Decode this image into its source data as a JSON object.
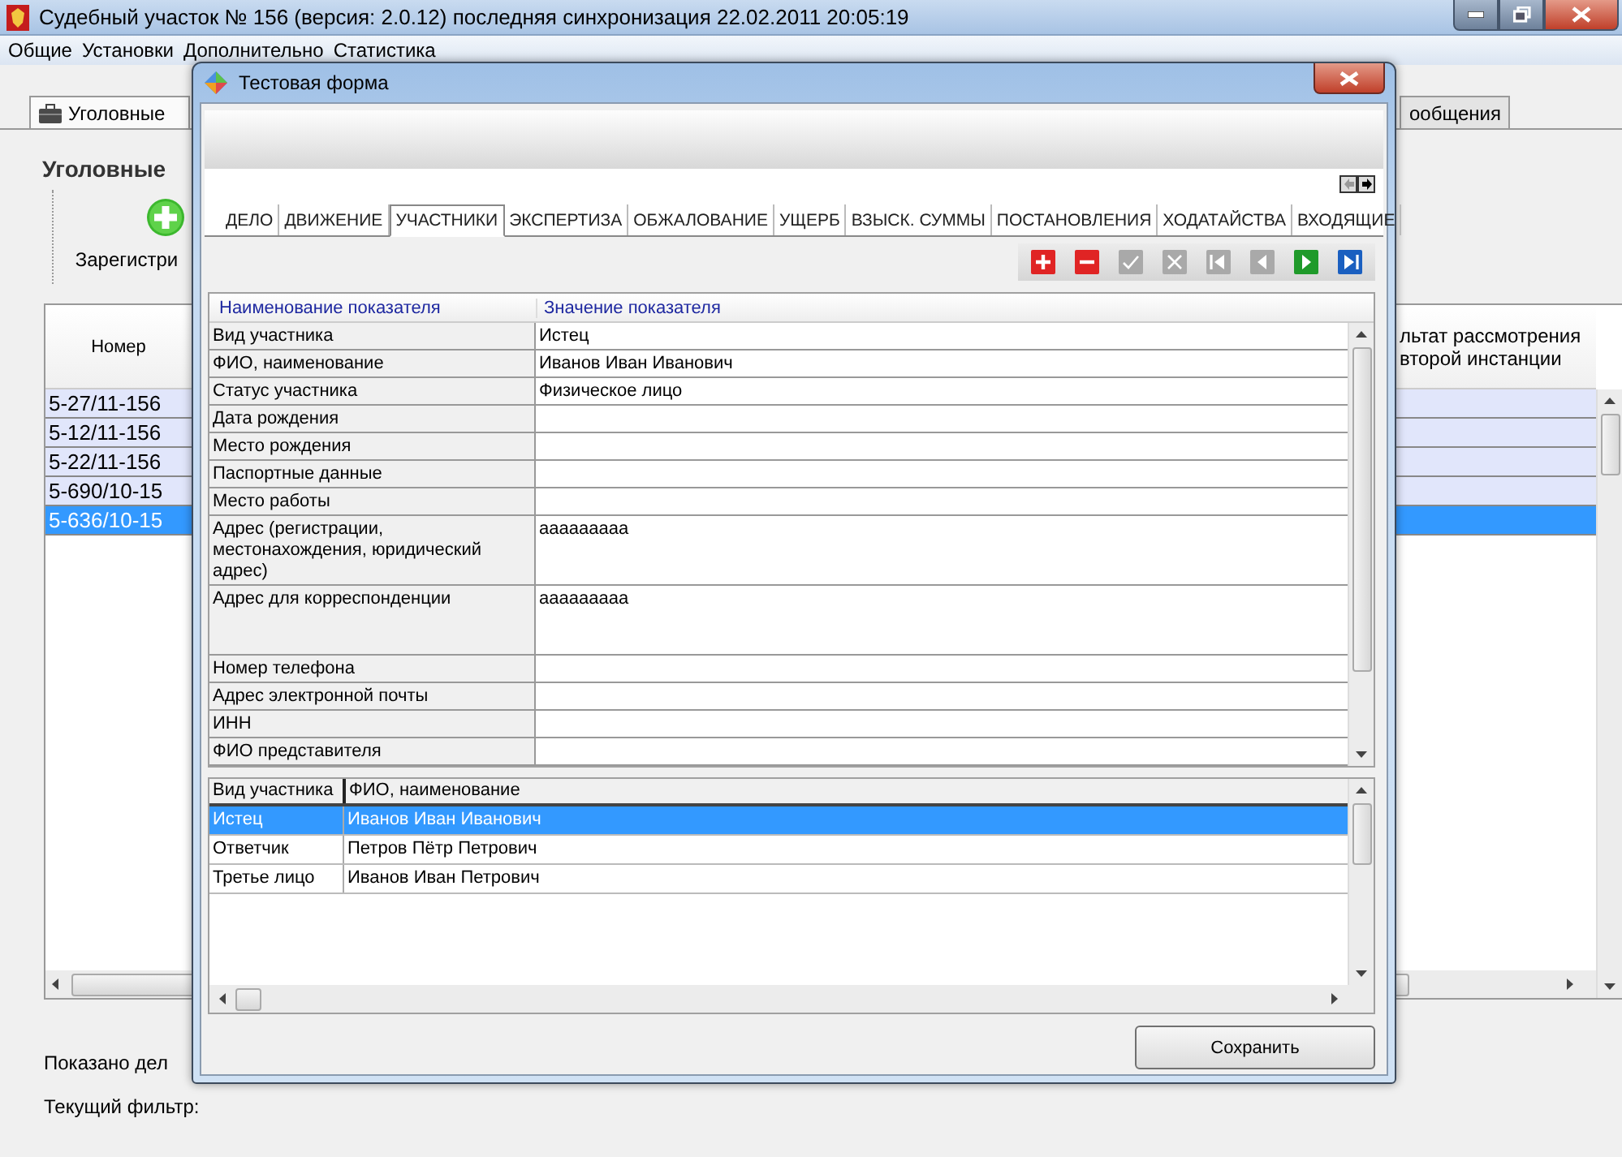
{
  "window": {
    "title": "Судебный участок № 156 (версия: 2.0.12) последняя синхронизация 22.02.2011 20:05:19"
  },
  "menu": [
    "Общие",
    "Установки",
    "Дополнительно",
    "Статистика"
  ],
  "main_tabs": [
    {
      "label": "Уголовные",
      "selected": true
    },
    {
      "label": "ообщения",
      "selected": false
    }
  ],
  "section_title": "Уголовные",
  "register_action": "Зарегистри",
  "cases_table": {
    "columns": [
      "Номер",
      "льтат рассмотрения\nвторой инстанции"
    ],
    "rows": [
      {
        "number": "5-27/11-156",
        "selected": false
      },
      {
        "number": "5-12/11-156",
        "selected": false
      },
      {
        "number": "5-22/11-156",
        "selected": false
      },
      {
        "number": "5-690/10-15",
        "selected": false
      },
      {
        "number": "5-636/10-15",
        "selected": true
      }
    ]
  },
  "footer": {
    "shown": "Показано дел",
    "filter": "Текущий фильтр:"
  },
  "dialog": {
    "title": "Тестовая форма",
    "tabs": [
      {
        "label": "ДЕЛО",
        "selected": false
      },
      {
        "label": "ДВИЖЕНИЕ",
        "selected": false
      },
      {
        "label": "УЧАСТНИКИ",
        "selected": true
      },
      {
        "label": "ЭКСПЕРТИЗА",
        "selected": false
      },
      {
        "label": "ОБЖАЛОВАНИЕ",
        "selected": false
      },
      {
        "label": "УЩЕРБ",
        "selected": false
      },
      {
        "label": "ВЗЫСК. СУММЫ",
        "selected": false
      },
      {
        "label": "ПОСТАНОВЛЕНИЯ",
        "selected": false
      },
      {
        "label": "ХОДАТАЙСТВА",
        "selected": false
      },
      {
        "label": "ВХОДЯЩИЕ",
        "selected": false
      }
    ],
    "toolbar": [
      {
        "kind": "add",
        "disabled": false
      },
      {
        "kind": "remove",
        "disabled": false
      },
      {
        "kind": "confirm",
        "disabled": true
      },
      {
        "kind": "cancel",
        "disabled": true
      },
      {
        "kind": "first",
        "disabled": true
      },
      {
        "kind": "prev",
        "disabled": true
      },
      {
        "kind": "next",
        "disabled": false
      },
      {
        "kind": "last",
        "disabled": false
      }
    ],
    "properties": {
      "columns": [
        "Наименование показателя",
        "Значение показателя"
      ],
      "rows": [
        {
          "name": "Вид участника",
          "value": "Истец"
        },
        {
          "name": "ФИО, наименование",
          "value": "Иванов Иван Иванович"
        },
        {
          "name": "Статус участника",
          "value": "Физическое лицо"
        },
        {
          "name": "Дата рождения",
          "value": ""
        },
        {
          "name": "Место рождения",
          "value": ""
        },
        {
          "name": "Паспортные данные",
          "value": ""
        },
        {
          "name": "Место работы",
          "value": ""
        },
        {
          "name": "Адрес (регистрации, местонахождения, юридический адрес)",
          "value": "ааааааааа"
        },
        {
          "name": "Адрес для корреспонденции",
          "value": "ааааааааа"
        },
        {
          "name": "Номер телефона",
          "value": ""
        },
        {
          "name": "Адрес электронной почты",
          "value": ""
        },
        {
          "name": "ИНН",
          "value": ""
        },
        {
          "name": "ФИО представителя",
          "value": ""
        }
      ]
    },
    "participants": {
      "columns": [
        "Вид участника",
        "ФИО, наименование"
      ],
      "rows": [
        {
          "role": "Истец",
          "name": "Иванов Иван Иванович",
          "selected": true
        },
        {
          "role": "Ответчик",
          "name": "Петров Пётр Петрович",
          "selected": false
        },
        {
          "role": "Третье лицо",
          "name": "Иванов Иван Петрович",
          "selected": false
        }
      ]
    },
    "save_button": "Сохранить"
  }
}
